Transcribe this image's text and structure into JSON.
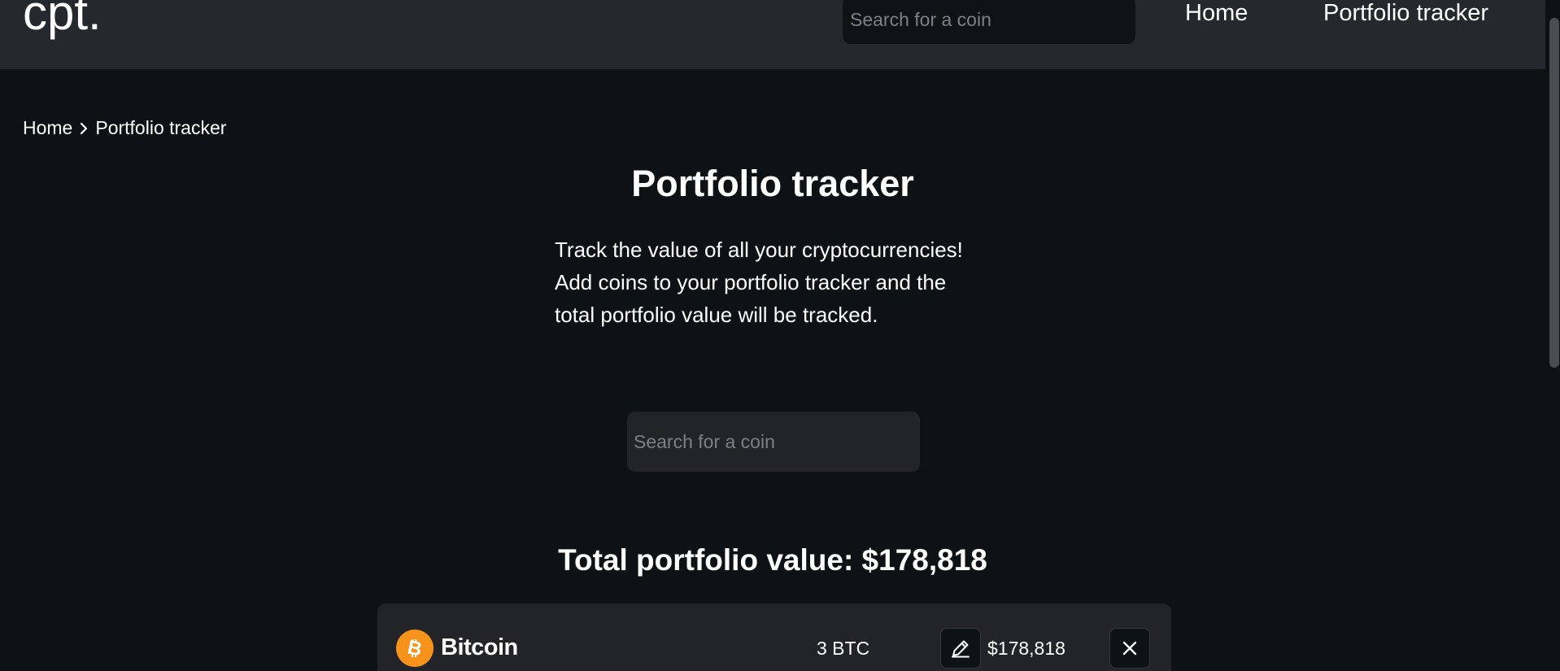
{
  "header": {
    "logo": "cpt.",
    "search_placeholder": "Search for a coin",
    "nav": {
      "home": "Home",
      "portfolio": "Portfolio tracker"
    }
  },
  "breadcrumb": {
    "items": [
      "Home",
      "Portfolio tracker"
    ]
  },
  "main": {
    "title": "Portfolio tracker",
    "description": [
      "Track the value of all your cryptocurrencies!",
      "Add coins to your portfolio tracker and the",
      "total portfolio value will be tracked."
    ],
    "search_placeholder": "Search for a coin",
    "total_label": "Total portfolio value: $178,818"
  },
  "portfolio": [
    {
      "icon": "bitcoin-icon",
      "name": "Bitcoin",
      "amount": "3 BTC",
      "value": "$178,818"
    }
  ],
  "colors": {
    "background": "#0f1215",
    "header": "#25282d",
    "card": "#222428",
    "bitcoin": "#f7931a"
  }
}
